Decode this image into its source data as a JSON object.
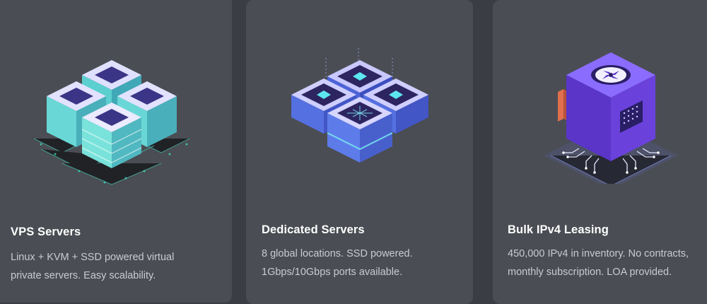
{
  "cards": [
    {
      "title": "VPS Servers",
      "description": [
        "Linux + KVM + SSD powered virtual",
        "private servers. Easy scalability."
      ],
      "icon": "vps-server-stack-icon"
    },
    {
      "title": "Dedicated Servers",
      "description": [
        "8 global locations. SSD powered.",
        "1Gbps/10Gbps ports available."
      ],
      "icon": "dedicated-server-cluster-icon"
    },
    {
      "title": "Bulk IPv4 Leasing",
      "description": [
        "450,000 IPv4 in inventory. No contracts,",
        "monthly subscription. LOA provided."
      ],
      "icon": "ipv4-chip-icon"
    }
  ],
  "colors": {
    "page_background": "#3a3d43",
    "card_background": "#4a4d53",
    "title_text": "#ffffff",
    "description_text": "#c9cbd0",
    "accent_teal": "#3fe0c8",
    "accent_purple": "#6a3fd1",
    "accent_blue": "#5a78e8"
  }
}
